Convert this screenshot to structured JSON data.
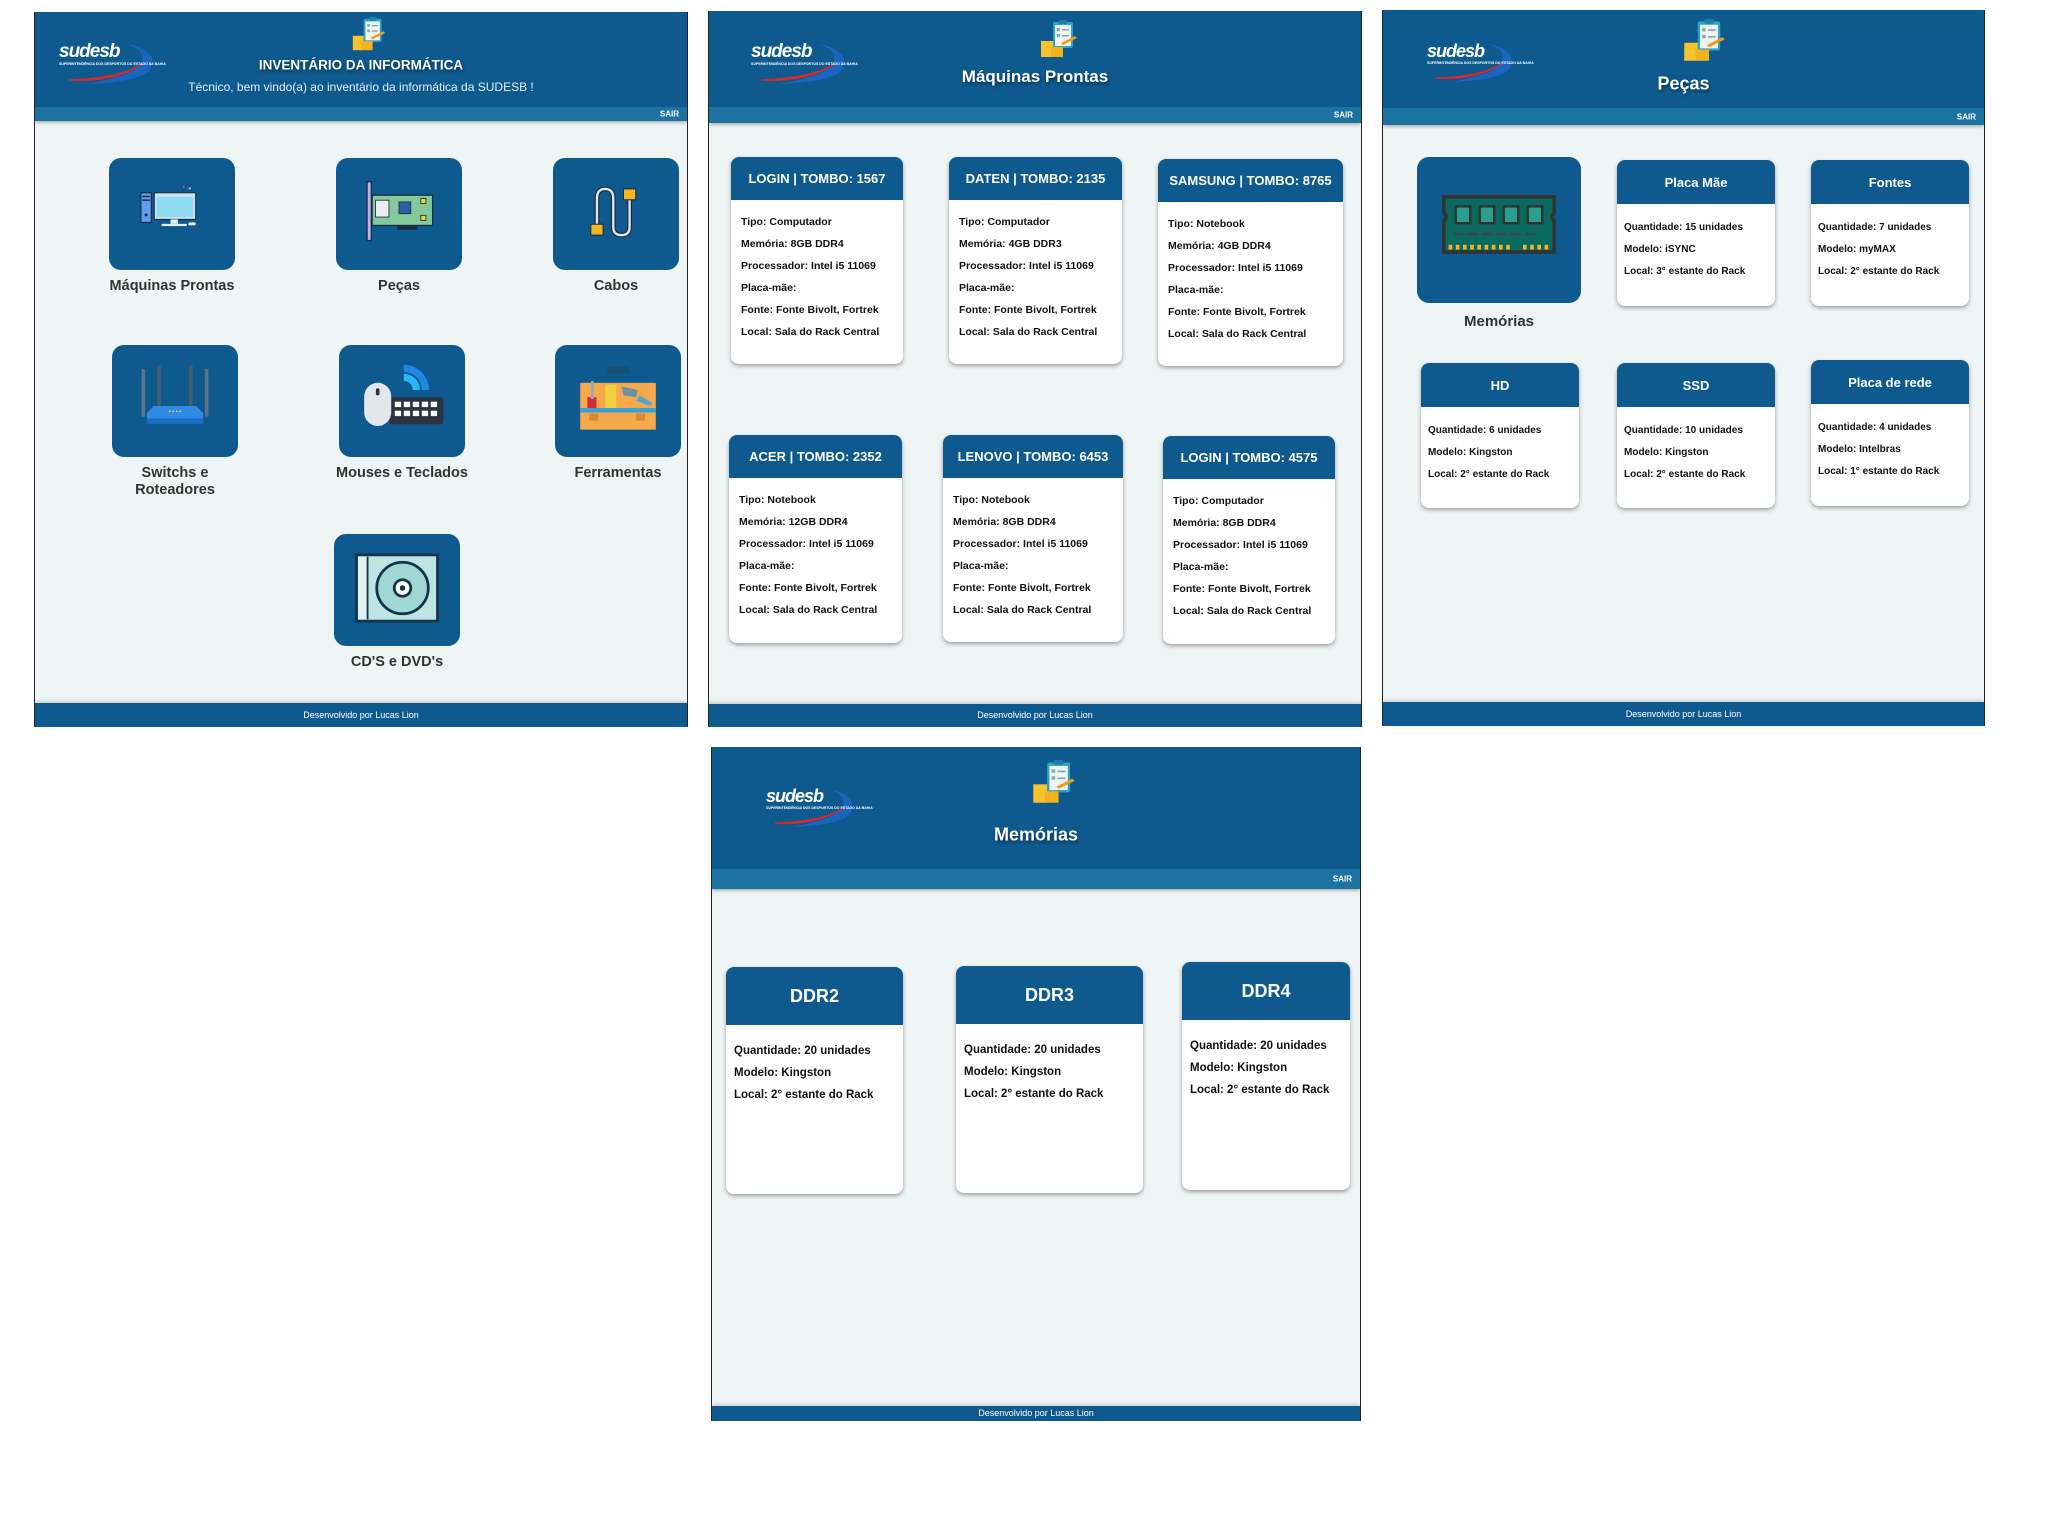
{
  "brand": {
    "logo_text": "sudesb",
    "logo_subtext": "SUPERINTENDÊNCIA DOS DESPORTOS DO ESTADO DA BAHIA",
    "colors": {
      "header": "#0e5a8f",
      "subbar": "#1c72a0",
      "background": "#eff4f5",
      "card": "#ffffff"
    }
  },
  "home": {
    "title": "INVENTÁRIO DA INFORMÁTICA",
    "subtitle": "Técnico, bem vindo(a) ao inventário da informática da SUDESB !",
    "logout": "SAIR",
    "footer": "Desenvolvido por Lucas Lion",
    "tiles": [
      {
        "label": "Máquinas Prontas",
        "icon": "desktop-computer-icon"
      },
      {
        "label": "Peças",
        "icon": "network-card-icon"
      },
      {
        "label": "Cabos",
        "icon": "cable-icon"
      },
      {
        "label": "Switchs e Roteadores",
        "icon": "router-icon"
      },
      {
        "label": "Mouses e Teclados",
        "icon": "mouse-keyboard-icon"
      },
      {
        "label": "Ferramentas",
        "icon": "toolbox-icon"
      },
      {
        "label": "CD'S e DVD's",
        "icon": "disc-icon"
      }
    ]
  },
  "machines": {
    "title": "Máquinas Prontas",
    "logout": "SAIR",
    "footer": "Desenvolvido por Lucas Lion",
    "cards": [
      {
        "header": "LOGIN | TOMBO: 1567",
        "lines": [
          "Tipo: Computador",
          "Memória: 8GB DDR4",
          "Processador: Intel i5 11069",
          "Placa-mãe:",
          "Fonte: Fonte Bivolt, Fortrek",
          "Local: Sala do Rack Central"
        ]
      },
      {
        "header": "DATEN | TOMBO: 2135",
        "lines": [
          "Tipo: Computador",
          "Memória: 4GB DDR3",
          "Processador: Intel i5 11069",
          "Placa-mãe:",
          "Fonte: Fonte Bivolt, Fortrek",
          "Local: Sala do Rack Central"
        ]
      },
      {
        "header": "SAMSUNG | TOMBO: 8765",
        "lines": [
          "Tipo: Notebook",
          "Memória: 4GB DDR4",
          "Processador: Intel i5 11069",
          "Placa-mãe:",
          "Fonte: Fonte Bivolt, Fortrek",
          "Local: Sala do Rack Central"
        ]
      },
      {
        "header": "ACER | TOMBO: 2352",
        "lines": [
          "Tipo: Notebook",
          "Memória: 12GB DDR4",
          "Processador: Intel i5 11069",
          "Placa-mãe:",
          "Fonte: Fonte Bivolt, Fortrek",
          "Local: Sala do Rack Central"
        ]
      },
      {
        "header": "LENOVO | TOMBO: 6453",
        "lines": [
          "Tipo: Notebook",
          "Memória: 8GB DDR4",
          "Processador: Intel i5 11069",
          "Placa-mãe:",
          "Fonte: Fonte Bivolt, Fortrek",
          "Local: Sala do Rack Central"
        ]
      },
      {
        "header": "LOGIN | TOMBO: 4575",
        "lines": [
          "Tipo: Computador",
          "Memória: 8GB DDR4",
          "Processador: Intel i5 11069",
          "Placa-mãe:",
          "Fonte: Fonte Bivolt, Fortrek",
          "Local: Sala do Rack Central"
        ]
      }
    ]
  },
  "parts": {
    "title": "Peças",
    "logout": "SAIR",
    "footer": "Desenvolvido por Lucas Lion",
    "tile": {
      "label": "Memórias",
      "icon": "ram-module-icon"
    },
    "cards": [
      {
        "header": "Placa Mãe",
        "lines": [
          "Quantidade: 15 unidades",
          "Modelo: iSYNC",
          "Local: 3° estante do Rack"
        ]
      },
      {
        "header": "Fontes",
        "lines": [
          "Quantidade: 7 unidades",
          "Modelo: myMAX",
          "Local: 2° estante do Rack"
        ]
      },
      {
        "header": "HD",
        "lines": [
          "Quantidade: 6 unidades",
          "Modelo: Kingston",
          "Local: 2° estante do Rack"
        ]
      },
      {
        "header": "SSD",
        "lines": [
          "Quantidade: 10 unidades",
          "Modelo: Kingston",
          "Local: 2° estante do Rack"
        ]
      },
      {
        "header": "Placa de rede",
        "lines": [
          "Quantidade: 4 unidades",
          "Modelo: Intelbras",
          "Local: 1° estante do Rack"
        ]
      }
    ]
  },
  "memories": {
    "title": "Memórias",
    "logout": "SAIR",
    "footer": "Desenvolvido por Lucas Lion",
    "cards": [
      {
        "header": "DDR2",
        "lines": [
          "Quantidade: 20 unidades",
          "Modelo: Kingston",
          "Local: 2° estante do Rack"
        ]
      },
      {
        "header": "DDR3",
        "lines": [
          "Quantidade: 20 unidades",
          "Modelo: Kingston",
          "Local: 2° estante do Rack"
        ]
      },
      {
        "header": "DDR4",
        "lines": [
          "Quantidade: 20 unidades",
          "Modelo: Kingston",
          "Local: 2° estante do Rack"
        ]
      }
    ]
  }
}
